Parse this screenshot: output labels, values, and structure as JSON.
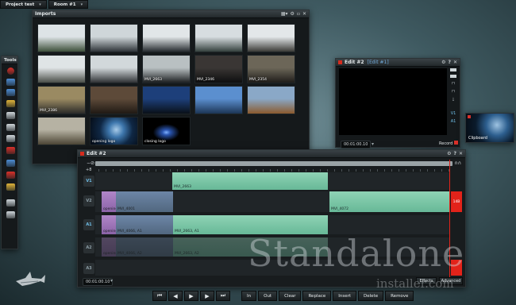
{
  "project_tabs": [
    {
      "label": "Project test"
    },
    {
      "label": "Room #1"
    }
  ],
  "tools": {
    "title": "Tools",
    "buttons": [
      {
        "icon": "record-icon",
        "color": "#d8312a"
      },
      {
        "icon": "capture-icon",
        "color": "#4d8dd4"
      },
      {
        "icon": "list-icon",
        "color": "#4d8dd4"
      },
      {
        "icon": "folder-icon",
        "color": "#e0b43a"
      },
      {
        "icon": "monitor-icon",
        "color": "#cfd6da"
      },
      {
        "icon": "film-icon",
        "color": "#cfd6da"
      },
      {
        "icon": "print-icon",
        "color": "#cfd6da"
      },
      {
        "icon": "grid-icon",
        "color": "#d8312a"
      },
      {
        "icon": "export-icon",
        "color": "#4d8dd4"
      },
      {
        "icon": "flag-icon",
        "color": "#d8312a"
      },
      {
        "icon": "arrow-icon",
        "color": "#e0b43a"
      },
      {
        "icon": "home-icon",
        "color": "#cfd6da"
      },
      {
        "icon": "trash-icon",
        "color": "#cfd6da"
      }
    ]
  },
  "imports": {
    "title": "Imports",
    "thumbnails": [
      {
        "label": "",
        "c1": "#dde3e6",
        "c2": "#3d4f3a"
      },
      {
        "label": "",
        "c1": "#cfd6d9",
        "c2": "#2e3338"
      },
      {
        "label": "",
        "c1": "#e1e6e8",
        "c2": "#262b2f"
      },
      {
        "label": "",
        "c1": "#d7dde0",
        "c2": "#34403d"
      },
      {
        "label": "",
        "c1": "#e3e7e9",
        "c2": "#3b3a36"
      },
      {
        "label": "",
        "c1": "#dfe4e6",
        "c2": "#4a4e48"
      },
      {
        "label": "",
        "c1": "#d2d8db",
        "c2": "#2f3235"
      },
      {
        "label": "MVI_2663",
        "c1": "#b9c0c2",
        "c2": "#1d2022"
      },
      {
        "label": "MVI_2346",
        "c1": "#3a3634",
        "c2": "#0e0f10"
      },
      {
        "label": "MVI_2354",
        "c1": "#6c6658",
        "c2": "#1f1d1a"
      },
      {
        "label": "MVI_2386",
        "c1": "#9a8a62",
        "c2": "#2a2a28"
      },
      {
        "label": "",
        "c1": "#5d4a39",
        "c2": "#1f1914"
      },
      {
        "label": "",
        "c1": "#1d3f7a",
        "c2": "#0a1018"
      },
      {
        "label": "",
        "c1": "#5b8fcf",
        "c2": "#1c3555"
      },
      {
        "label": "",
        "c1": "#8aa8c7",
        "c2": "#8b5a2e"
      },
      {
        "label": "",
        "c1": "#b6b2a3",
        "c2": "#4b4434"
      },
      {
        "label": "opening logo",
        "c1": "#4f7ea8",
        "c2": "#0a1420"
      },
      {
        "label": "closing logo",
        "c1": "#1a2f55",
        "c2": "#000000"
      }
    ]
  },
  "edit2": {
    "title": "Edit #2",
    "tab": "[Edit #1]",
    "timecode": "00:01:00.10",
    "record_label": "Record",
    "strip_labels": [
      "V1",
      "A1"
    ]
  },
  "clipboard": {
    "label": "Clipboard"
  },
  "edit1": {
    "title": "Edit #2",
    "timecode": "00:01:00.10",
    "row_label": "+8",
    "tracks": [
      {
        "label": "V1",
        "active": true
      },
      {
        "label": "V2",
        "active": false
      },
      {
        "label": "A1",
        "active": true
      },
      {
        "label": "A2",
        "active": false
      },
      {
        "label": "A3",
        "active": false
      }
    ],
    "clips": {
      "v1_top": "MVI_2663",
      "v2_a": "opening",
      "v2_b": "MVI_4001",
      "v2_c": "MVI_4072",
      "a1_a": "opening",
      "a1_b": "MVI_4066, A1",
      "a1_c": "MVI_2663, A1",
      "a2_a": "opening",
      "a2_b": "MVI_4066, A2",
      "a2_c": "MVI_2663, A2"
    },
    "marker_label": "14B",
    "effects_label": "Effects",
    "advanced_label": "Advanced"
  },
  "transport": {
    "buttons": [
      {
        "icon": "jump-start-icon",
        "glyph": "⏮"
      },
      {
        "icon": "step-back-icon",
        "glyph": "◀"
      },
      {
        "icon": "play-icon",
        "glyph": "▶"
      },
      {
        "icon": "step-forward-icon",
        "glyph": "▶"
      },
      {
        "icon": "jump-end-icon",
        "glyph": "⏭"
      }
    ],
    "actions": [
      "In",
      "Out",
      "Clear",
      "Replace",
      "Insert",
      "Delete",
      "Remove"
    ]
  },
  "watermark": {
    "main": "Standalone",
    "sub": "installer.com"
  }
}
